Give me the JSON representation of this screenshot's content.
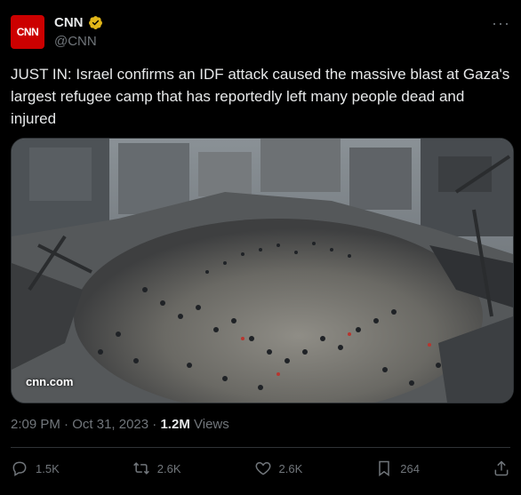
{
  "author": {
    "avatar_text": "CNN",
    "name": "CNN",
    "handle": "@CNN",
    "avatar_color": "#cc0000",
    "verified_color": "#e2b719"
  },
  "more_label": "···",
  "tweet": {
    "text": "JUST IN: Israel confirms an IDF attack caused the massive blast at Gaza's largest refugee camp that has reportedly left many people dead and injured"
  },
  "media": {
    "watermark": "cnn.com"
  },
  "meta": {
    "time": "2:09 PM",
    "separator": "·",
    "date": "Oct 31, 2023",
    "views_count": "1.2M",
    "views_label": "Views"
  },
  "actions": {
    "replies": "1.5K",
    "reposts": "2.6K",
    "likes": "2.6K",
    "bookmarks": "264"
  },
  "icons": {
    "reply": "reply-icon",
    "repost": "repost-icon",
    "like": "heart-icon",
    "bookmark": "bookmark-icon",
    "share": "share-icon"
  }
}
